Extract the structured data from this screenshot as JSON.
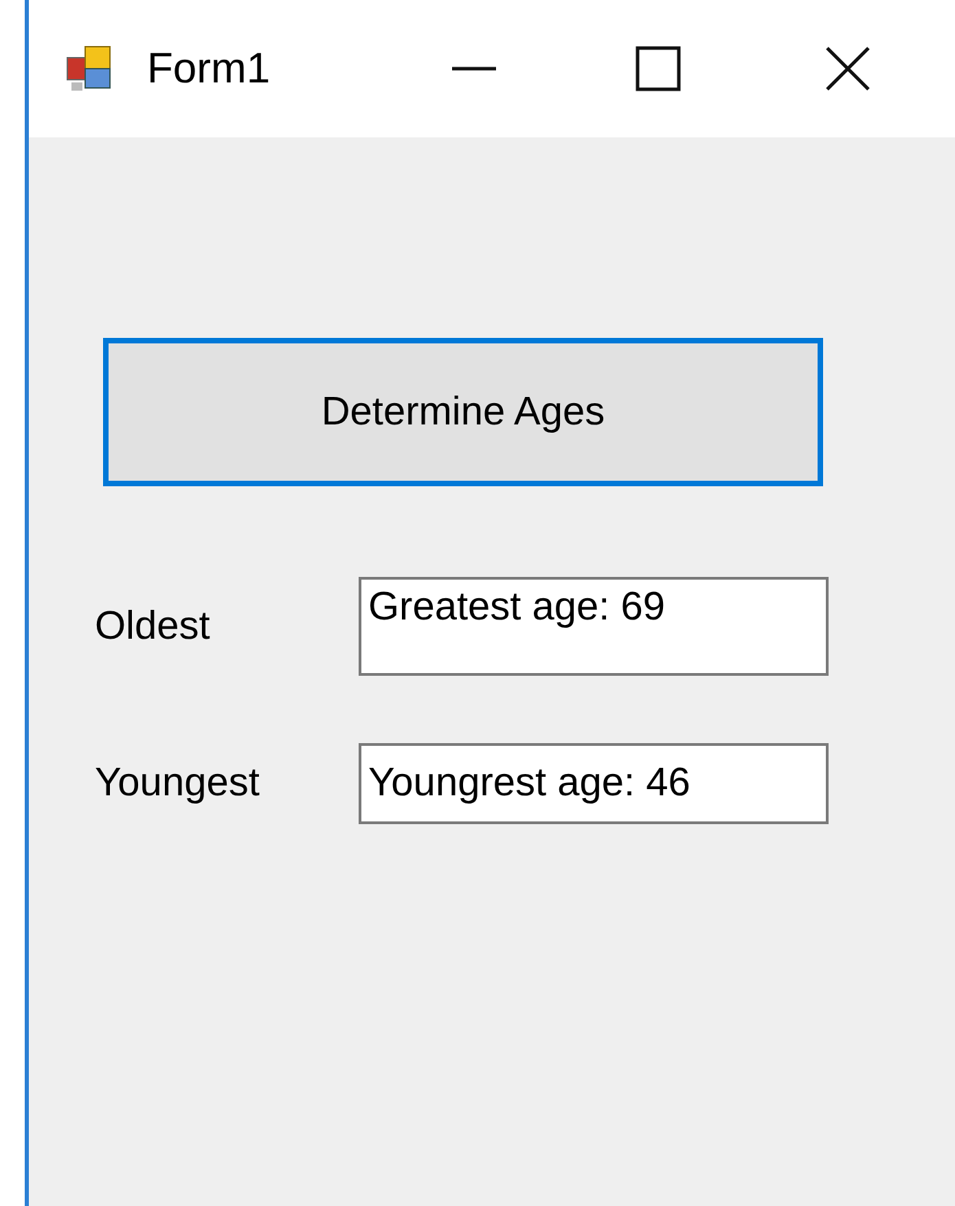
{
  "window": {
    "title": "Form1"
  },
  "button": {
    "label": "Determine Ages"
  },
  "fields": [
    {
      "label": "Oldest",
      "value": "Greatest age: 69"
    },
    {
      "label": "Youngest",
      "value": "Youngrest age: 46"
    }
  ]
}
